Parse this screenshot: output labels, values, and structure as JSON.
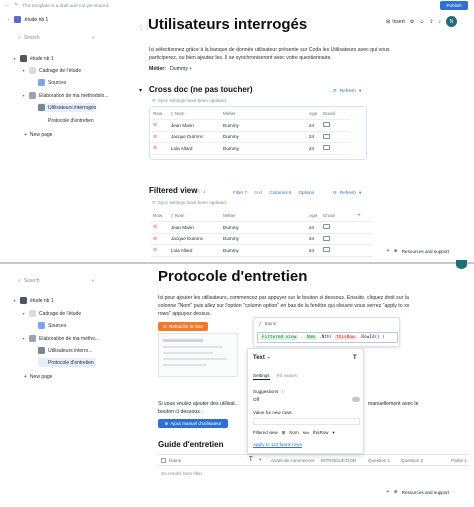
{
  "banner": {
    "text": "This template is a draft and not yet shared.",
    "publish": "Publish"
  },
  "doc_title": "étude nb 1",
  "toolbar": {
    "insert": "Insert",
    "avatar": "N"
  },
  "sidebar_top": {
    "search": "Search",
    "root": "étude nb 1",
    "items": [
      "Cadrage de l'étude",
      "Sources",
      "Elaboration de ma méthodolo...",
      "Utilisateurs interrogés",
      "Protocole d'entretien"
    ],
    "new_page": "New page"
  },
  "sidebar_bottom": {
    "search": "Search",
    "root": "étude nb 1",
    "items": [
      "Cadrage de l'étude",
      "Sources",
      "Elaboration de ma métho...",
      "Utilisateurs interro...",
      "Protocole d'entretien"
    ],
    "new_page": "New page"
  },
  "page1": {
    "title": "Utilisateurs interrogés",
    "intro": "Ici sélectionnez grâce à la banque de donnée utilisateur présente sur Coda les Utilisateurs avec qui vous participerez, ou bien ajoutez les. Il se synchroniseront avec votre questionnaire.",
    "metier_label": "Métier:",
    "metier_value": "Dummy",
    "cross_doc": {
      "title": "Cross doc (ne pas toucher)",
      "refresh": "Refresh",
      "sync_note": "Sync settings have been updated.",
      "columns": [
        "Row",
        "Nom",
        "Métier",
        "Age",
        "Email"
      ],
      "rows": [
        {
          "nom": "Jean Marin",
          "metier": "Dummy",
          "age": "24"
        },
        {
          "nom": "Jacque Dutronc",
          "metier": "Dummy",
          "age": "24"
        },
        {
          "nom": "Lola Allard",
          "metier": "Dummy",
          "age": "24"
        }
      ]
    },
    "filtered": {
      "title": "Filtered view",
      "count": "Ⓒ 1",
      "filter": "Filter 7",
      "sort": "Sort",
      "columns_btn": "Columns 5",
      "options": "Options",
      "refresh": "Refresh",
      "sync_note": "Sync settings have been updated.",
      "columns": [
        "Row",
        "Nom",
        "Métier",
        "Age",
        "Email"
      ],
      "rows": [
        {
          "nom": "Jean Marin",
          "metier": "Dummy",
          "age": "24"
        },
        {
          "nom": "Jacque Dutronc",
          "metier": "Dummy",
          "age": "24"
        },
        {
          "nom": "Lola Allard",
          "metier": "Dummy",
          "age": "24"
        }
      ]
    },
    "resources": "Resources and support"
  },
  "page2": {
    "title": "Protocole d'entretien",
    "intro": "Ici pour ajouter les utilisateurs, commencez par appuyer sur le bouton si dessous. Ensuite, cliquez droit sur la colonne \"Nom\" puis allez sur l'option \"column option\" en bas de la fenêtre qui slouvre vous verrez \"apply to xx rows\" appuyez dessus.",
    "refresh_btn": "Rafraichir la liste",
    "manual_intro": "Si vous voulez ajouter des utilisat...",
    "manual_tail": "manuellement avec le",
    "manual_line2": "bouton ci dessous :",
    "manual_btn": "Ajout manuel d'utilisateur",
    "guide": {
      "title": "Guide d'entretien",
      "columns": [
        "Name",
        "Avant de commencer",
        "INTRODUCTION",
        "Question 1",
        "Question 2",
        "Partie 1"
      ],
      "empty": "No results from filter"
    },
    "resources": "Resources and support"
  },
  "formula_bar": {
    "label": "Blank",
    "formula_prefix": "Filtered view",
    "formula_mid": "Nom",
    "formula_fn": "thisRow",
    "formula_tail": ".RowId()"
  },
  "column_panel": {
    "title": "Text",
    "tabs": [
      "Settings",
      "Fill values"
    ],
    "suggestions": "Suggestions",
    "off": "Off",
    "value_new_rows": "Value for new rows",
    "formula_a": "Filtered view",
    "formula_b": "Nom",
    "formula_c": "thisRow",
    "apply": "Apply to 123 blank rows"
  }
}
